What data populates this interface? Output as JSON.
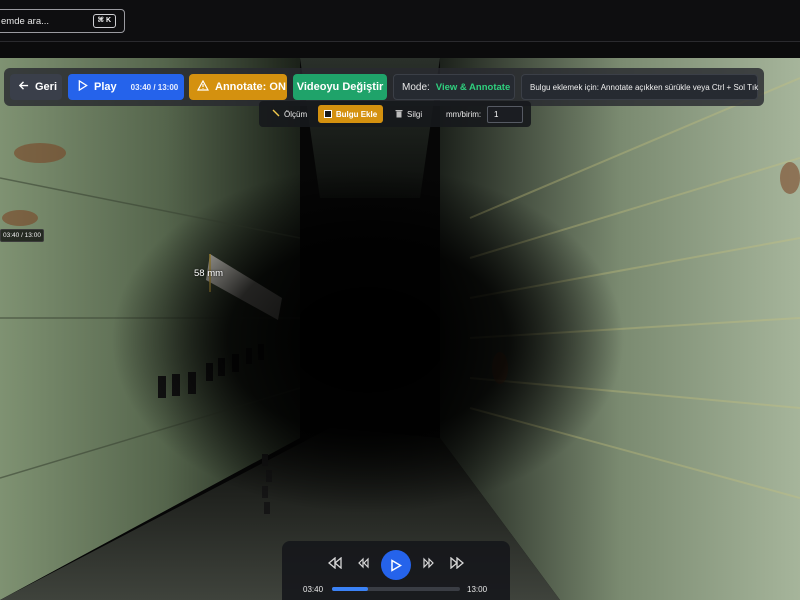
{
  "search": {
    "text": "emde ara...",
    "shortcut": "⌘ K"
  },
  "toolbar": {
    "back_label": "Geri",
    "play_label": "Play",
    "play_time": "03:40 / 13:00",
    "annotate_label": "Annotate: ON",
    "change_video_label": "Videoyu Değiştir",
    "mode_key": "Mode:",
    "mode_value": "View & Annotate",
    "hint": "Bulgu eklemek için: Annotate açıkken sürükle veya Ctrl + Sol Tık"
  },
  "annotation_tools": {
    "measure_label": "Ölçüm",
    "add_finding_label": "Bulgu Ekle",
    "eraser_label": "Silgi",
    "unit_label": "mm/birim:",
    "unit_value": "1"
  },
  "overlay": {
    "timestamp": "03:40 / 13:00",
    "measurement": "58 mm"
  },
  "player": {
    "current_time": "03:40",
    "total_time": "13:00",
    "progress": 0.282
  },
  "colors": {
    "accent_blue": "#2563eb",
    "annotate_orange": "#d4910f",
    "change_green": "#1fa36a",
    "mode_green": "#2fd07e"
  }
}
